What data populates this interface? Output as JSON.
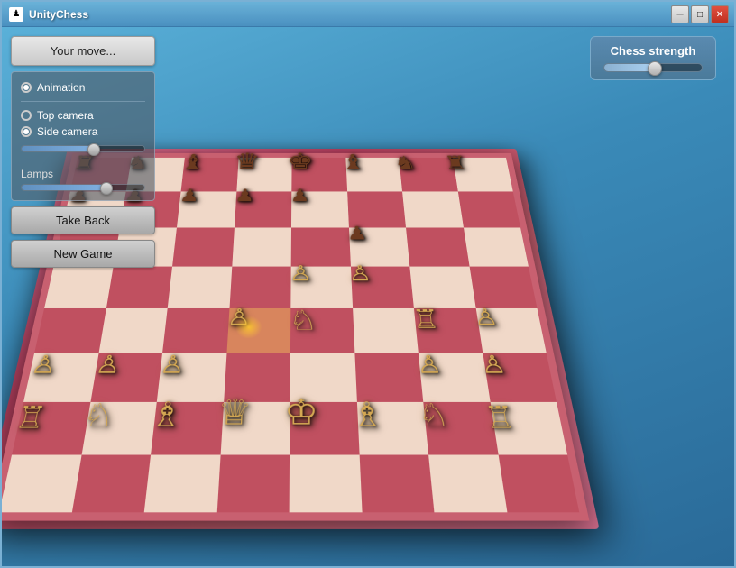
{
  "window": {
    "title": "UnityChess",
    "controls": {
      "minimize": "─",
      "maximize": "□",
      "close": "✕"
    }
  },
  "header": {
    "your_move_label": "Your move..."
  },
  "strength_panel": {
    "label": "Chess strength",
    "slider_value": 50
  },
  "controls": {
    "animation_label": "Animation",
    "top_camera_label": "Top camera",
    "side_camera_label": "Side camera",
    "lamps_label": "Lamps",
    "animation_checked": true,
    "top_camera_checked": false,
    "side_camera_checked": true
  },
  "buttons": {
    "take_back": "Take Back",
    "new_game": "New Game"
  },
  "board": {
    "colors": {
      "light": "#f0d8c8",
      "dark": "#c05060",
      "surround": "#c86070"
    }
  }
}
